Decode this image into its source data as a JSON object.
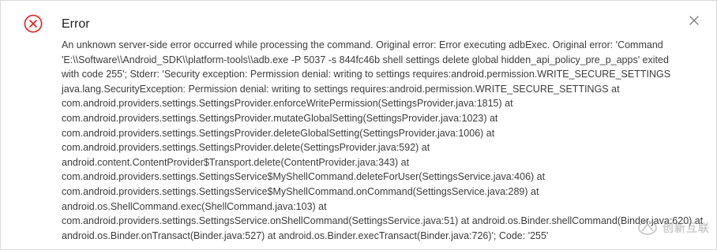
{
  "dialog": {
    "title": "Error",
    "close_icon": "close-icon",
    "status_icon": "error-circle-icon",
    "error_color": "#e02020",
    "message_lines": [
      "An unknown server-side error occurred while processing the command. Original error: Error executing adbExec. Original error: 'Command",
      "'E:\\\\Software\\\\Android_SDK\\\\platform-tools\\\\adb.exe -P 5037 -s 844fc46b shell settings delete global hidden_api_policy_pre_p_apps' exited",
      "with code 255'; Stderr: 'Security exception: Permission denial: writing to settings requires:android.permission.WRITE_SECURE_SETTINGS",
      "java.lang.SecurityException: Permission denial: writing to settings requires:android.permission.WRITE_SECURE_SETTINGS at",
      "com.android.providers.settings.SettingsProvider.enforceWritePermission(SettingsProvider.java:1815) at",
      "com.android.providers.settings.SettingsProvider.mutateGlobalSetting(SettingsProvider.java:1023) at",
      "com.android.providers.settings.SettingsProvider.deleteGlobalSetting(SettingsProvider.java:1006) at",
      "com.android.providers.settings.SettingsProvider.delete(SettingsProvider.java:592) at",
      "android.content.ContentProvider$Transport.delete(ContentProvider.java:343) at",
      "com.android.providers.settings.SettingsService$MyShellCommand.deleteForUser(SettingsService.java:406) at",
      "com.android.providers.settings.SettingsService$MyShellCommand.onCommand(SettingsService.java:289) at",
      "android.os.ShellCommand.exec(ShellCommand.java:103) at",
      "com.android.providers.settings.SettingsService.onShellCommand(SettingsService.java:51) at android.os.Binder.shellCommand(Binder.java:620) at",
      "android.os.Binder.onTransact(Binder.java:527) at android.os.Binder.execTransact(Binder.java:726)'; Code: '255'"
    ]
  },
  "watermark": {
    "text": "创新互联",
    "icon": "watermark-logo-icon"
  }
}
